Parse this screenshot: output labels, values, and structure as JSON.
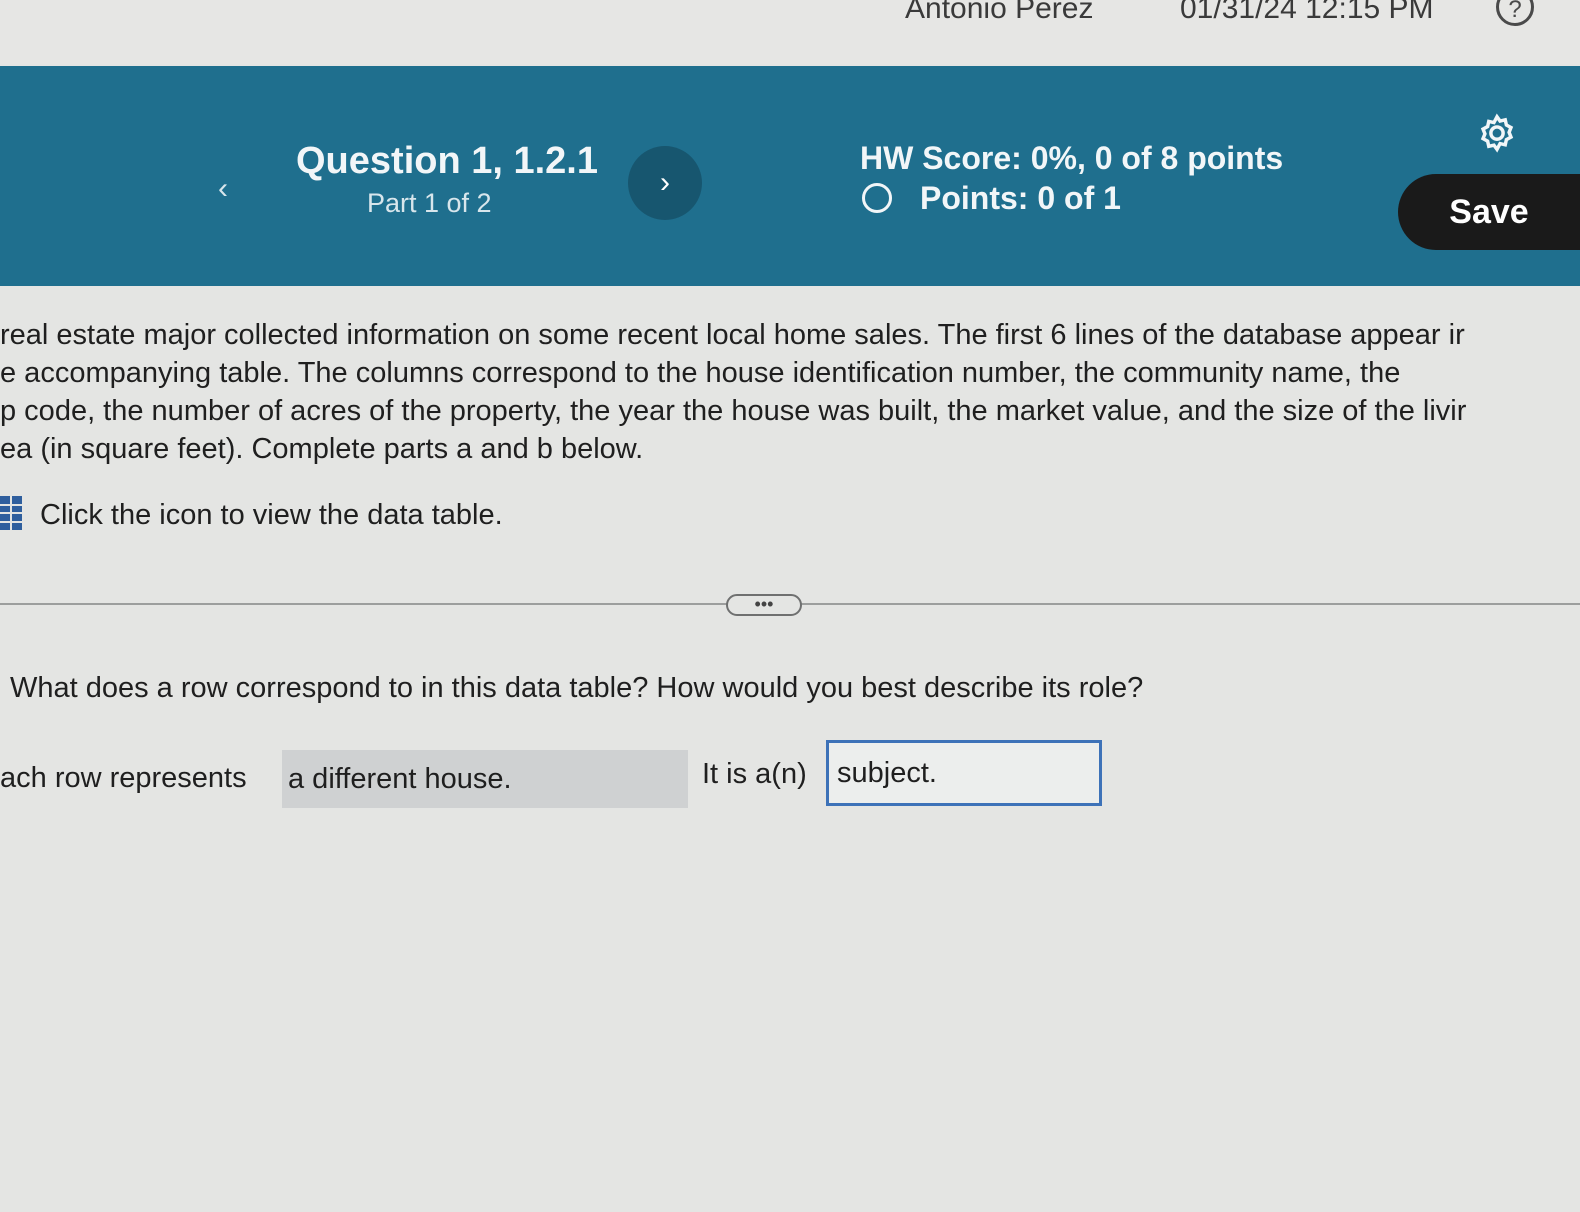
{
  "topbar": {
    "user_name": "Antonio Perez",
    "timestamp": "01/31/24 12:15 PM",
    "help_glyph": "?"
  },
  "header": {
    "prev_glyph": "‹",
    "question_title": "Question 1, 1.2.1",
    "part": "Part 1 of 2",
    "next_glyph": "›",
    "hw_score": "HW Score: 0%, 0 of 8 points",
    "points": "Points: 0 of 1",
    "save_label": "Save",
    "icons": {
      "settings": "gear-icon",
      "status": "circle-icon"
    },
    "colors": {
      "bar": "#1f6f8e",
      "save": "#1a1a1a"
    }
  },
  "stem": {
    "lines": [
      "real estate major collected information on some recent local home sales. The first 6 lines of the database appear ir",
      "e accompanying table. The columns correspond to the house identification number, the community name, the",
      "p code, the number of acres of the property, the year the house was built, the market value, and the size of the livir",
      "ea (in square feet). Complete parts a and b below."
    ],
    "data_link": "Click the icon to view the data table."
  },
  "expand_glyph": "•••",
  "question": "What does a row correspond to in this data table? How would you best describe its role?",
  "answer": {
    "prefix": "ach row represents",
    "selected": "a different house.",
    "middle": "It is a(n)",
    "input_value": "subject."
  }
}
